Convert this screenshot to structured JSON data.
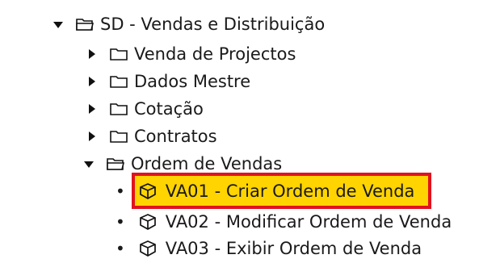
{
  "tree": {
    "root": {
      "label": "SD - Vendas e Distribuição",
      "expanded": true
    },
    "children": [
      {
        "label": "Venda de Projectos",
        "expanded": false
      },
      {
        "label": "Dados Mestre",
        "expanded": false
      },
      {
        "label": "Cotação",
        "expanded": false
      },
      {
        "label": "Contratos",
        "expanded": false
      },
      {
        "label": "Ordem de Vendas",
        "expanded": true
      }
    ],
    "transactions": [
      {
        "label": "VA01 - Criar Ordem de Venda",
        "selected": true
      },
      {
        "label": "VA02 - Modificar Ordem de Venda",
        "selected": false
      },
      {
        "label": "VA03 - Exibir Ordem de Venda",
        "selected": false
      }
    ]
  },
  "colors": {
    "highlight_fill": "#ffd400",
    "highlight_border": "#e1121f"
  }
}
